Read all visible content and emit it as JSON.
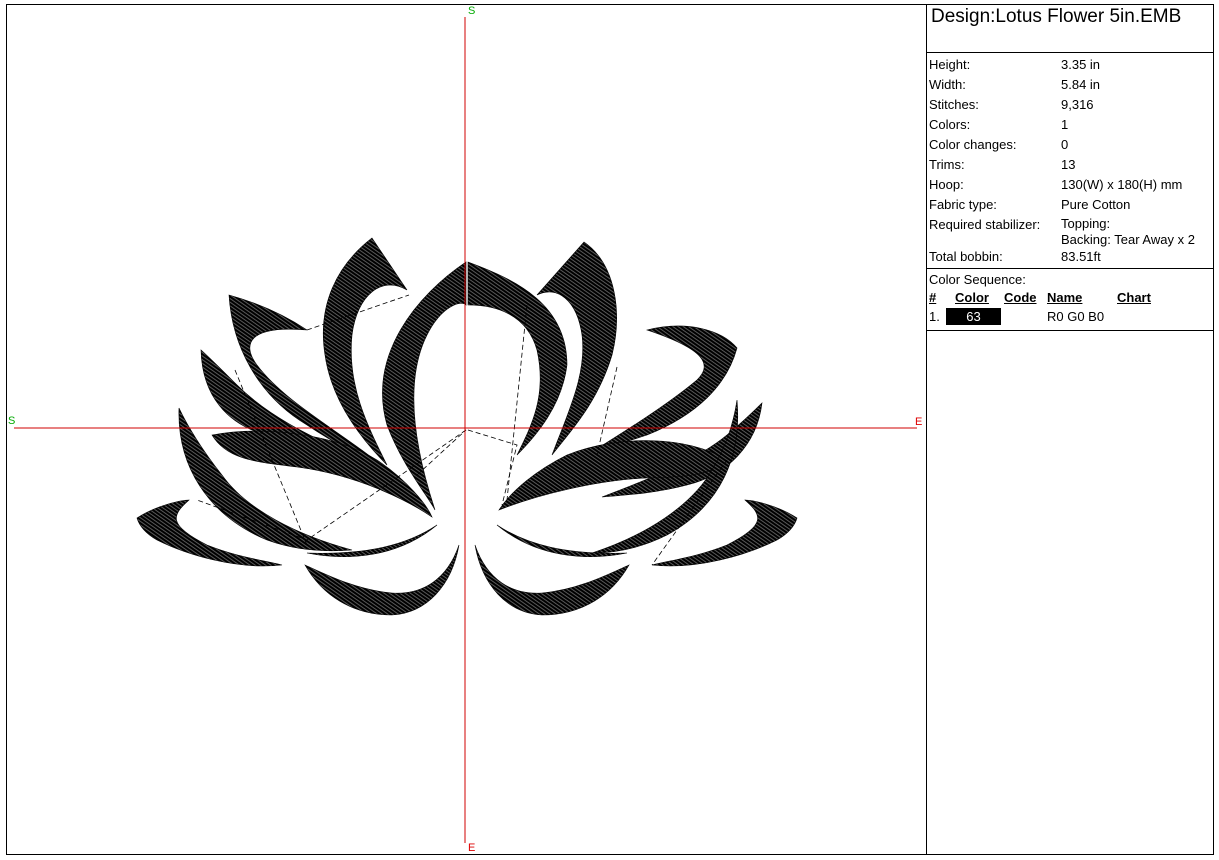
{
  "design": {
    "title": "Design:Lotus Flower 5in.EMB"
  },
  "properties": [
    {
      "label": "Height:",
      "value": "3.35 in"
    },
    {
      "label": "Width:",
      "value": "5.84 in"
    },
    {
      "label": "Stitches:",
      "value": "9,316"
    },
    {
      "label": "Colors:",
      "value": "1"
    },
    {
      "label": "Color changes:",
      "value": "0"
    },
    {
      "label": "Trims:",
      "value": "13"
    },
    {
      "label": "Hoop:",
      "value": "130(W) x 180(H) mm"
    },
    {
      "label": "Fabric type:",
      "value": "Pure Cotton"
    },
    {
      "label": "Required stabilizer:",
      "value": "Topping:",
      "value2": "Backing: Tear Away x 2"
    },
    {
      "label": "Total bobbin:",
      "value": "83.51ft"
    }
  ],
  "color_sequence": {
    "title": "Color Sequence:",
    "headers": {
      "num": "#",
      "color": "Color",
      "code": "Code",
      "name": "Name",
      "chart": "Chart"
    },
    "entries": [
      {
        "num": "1.",
        "color_label": "63",
        "swatch": "#000000",
        "code": "",
        "name": "R0 G0 B0",
        "chart": ""
      }
    ]
  },
  "canvas": {
    "axis_start_top": "S",
    "axis_end_bottom": "E",
    "axis_start_left": "S",
    "axis_end_right": "E",
    "crosshair_color": "#d00000",
    "start_marker_color": "#00aa00",
    "stitch_color": "#000000"
  }
}
